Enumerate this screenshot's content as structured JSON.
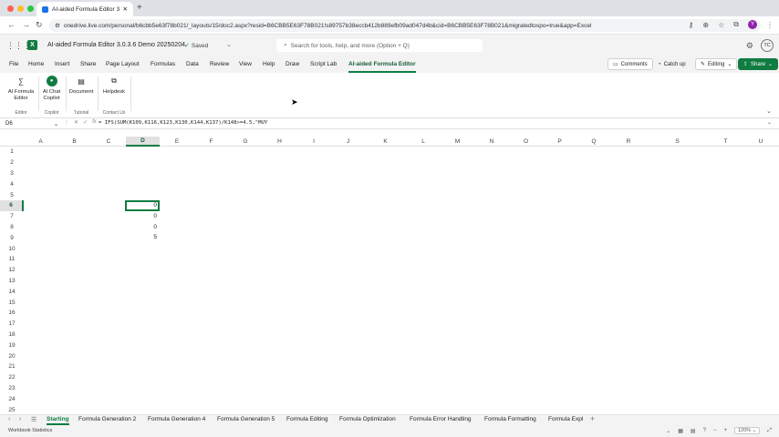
{
  "browser": {
    "tab_title": "AI-aided Formula Editor 3.0.3...",
    "url": "onedrive.live.com/personal/b6cbb5e63f78b021/_layouts/15/doc2.aspx?resid=B6CBB5E63F78B021!s89757b38eccb412b889efb09ad047d4b&cid=B6CBB5E63F78B021&migratedtospo=true&app=Excel",
    "profile_initial": "Y"
  },
  "app": {
    "title": "AI-aided Formula Editor 3.0.3.6 Demo 20250204",
    "saved_label": "Saved",
    "search_placeholder": "Search for tools, help, and more (Option + Q)",
    "user_initials": "TC",
    "brand_color": "#107c41"
  },
  "menu": {
    "items": [
      "File",
      "Home",
      "Insert",
      "Share",
      "Page Layout",
      "Formulas",
      "Data",
      "Review",
      "View",
      "Help",
      "Draw",
      "Script Lab",
      "AI-aided Formula Editor"
    ],
    "active": "AI-aided Formula Editor",
    "comments": "Comments",
    "catchup": "Catch up",
    "editing": "Editing",
    "share": "Share"
  },
  "ribbon": {
    "groups": [
      {
        "button": "AI Formula Editor",
        "group": "Editor"
      },
      {
        "button": "AI Chat Copilot",
        "group": "Copilot"
      },
      {
        "button": "Document",
        "group": "Tutorial"
      },
      {
        "button": "Helpdesk",
        "group": "Contact Us"
      }
    ]
  },
  "formula_bar": {
    "name_box": "D6",
    "formula": "= IFS(SUM(K109,K116,K123,K130,K144,K137)/K148>=4.5,\"MUY"
  },
  "grid": {
    "columns": [
      "A",
      "B",
      "C",
      "D",
      "E",
      "F",
      "G",
      "H",
      "I",
      "J",
      "K",
      "L",
      "M",
      "N",
      "O",
      "P",
      "Q",
      "R",
      "S",
      "T",
      "U"
    ],
    "selected_column": "D",
    "rows": [
      "1",
      "2",
      "3",
      "4",
      "5",
      "6",
      "7",
      "8",
      "9",
      "10",
      "11",
      "12",
      "13",
      "14",
      "15",
      "16",
      "17",
      "18",
      "19",
      "20",
      "21",
      "22",
      "23",
      "24",
      "25"
    ],
    "selected_row": "6",
    "cells": [
      {
        "col": "D",
        "row": "6",
        "value": "0"
      },
      {
        "col": "D",
        "row": "7",
        "value": "0"
      },
      {
        "col": "D",
        "row": "8",
        "value": "0"
      },
      {
        "col": "D",
        "row": "9",
        "value": "5"
      }
    ]
  },
  "sheets": {
    "tabs": [
      "Starting",
      "Formula Generation 2",
      "Formula Generation 4",
      "Formula Generation 5",
      "Formula Editing",
      "Formula Optimization",
      "Formula Error Handling",
      "Formula Formatting",
      "Formula Expl"
    ],
    "active": "Starting"
  },
  "status": {
    "workbook_stats": "Workbook Statistics",
    "zoom": "120%"
  }
}
